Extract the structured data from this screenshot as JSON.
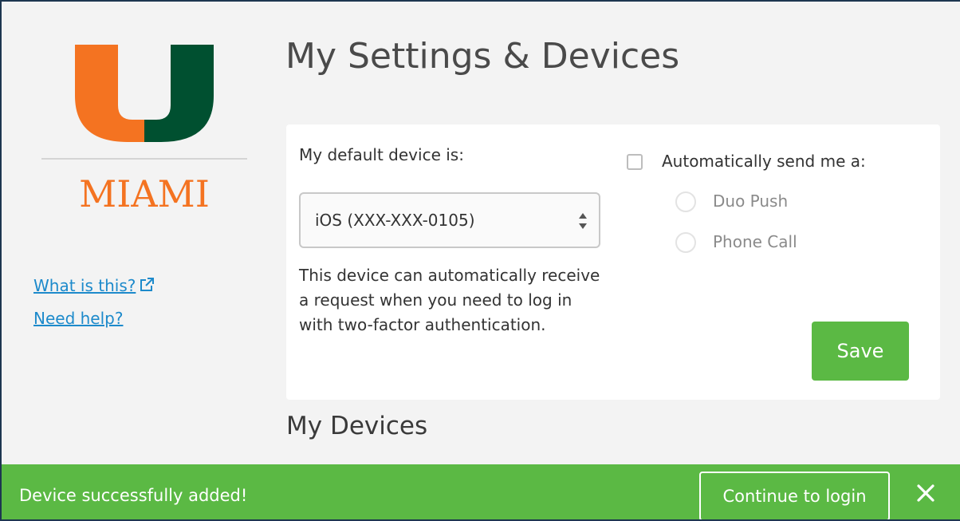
{
  "brand": {
    "wordmark": "MIAMI",
    "colors": {
      "orange": "#f47321",
      "green": "#005030"
    }
  },
  "sidebar": {
    "what_is_this": "What is this?",
    "need_help": "Need help?"
  },
  "page": {
    "title": "My Settings & Devices"
  },
  "settings": {
    "default_device_label": "My default device is:",
    "selected_device": "iOS (XXX-XXX-0105)",
    "device_description": "This device can automatically receive a request when you need to log in with two-factor authentication.",
    "auto_send_label": "Automatically send me a:",
    "auto_send_checked": false,
    "options": [
      "Duo Push",
      "Phone Call"
    ],
    "save_label": "Save"
  },
  "devices": {
    "heading": "My Devices"
  },
  "banner": {
    "message": "Device successfully added!",
    "continue_label": "Continue to login",
    "color": "#5bb944"
  },
  "icons": {
    "external_link": "external-link-icon",
    "select_arrows": "select-arrows-icon",
    "close": "close-icon"
  }
}
